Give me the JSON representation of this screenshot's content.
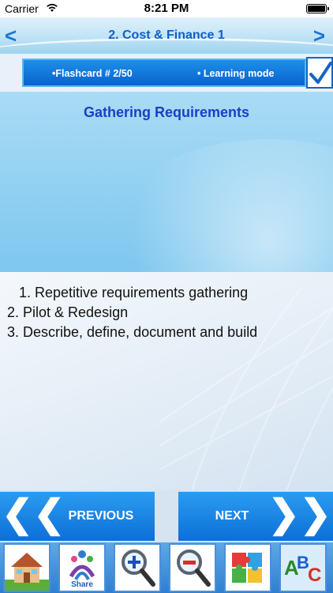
{
  "status_bar": {
    "carrier": "Carrier",
    "time": "8:21 PM"
  },
  "header": {
    "title": "2. Cost & Finance 1",
    "back_glyph": "<",
    "forward_glyph": ">"
  },
  "card_info": {
    "flashcard_label": "•Flashcard #  2/50",
    "mode_label": "• Learning mode",
    "checked": true
  },
  "question": {
    "text": "Gathering Requirements"
  },
  "answers": [
    "1. Repetitive requirements gathering",
    "2. Pilot & Redesign",
    "3. Describe, define, document and build"
  ],
  "buttons": {
    "previous": "PREVIOUS",
    "next": "NEXT"
  },
  "toolbar": {
    "items": [
      {
        "icon": "home-icon",
        "label": ""
      },
      {
        "icon": "share-icon",
        "label": "Share"
      },
      {
        "icon": "zoom-in-icon",
        "label": ""
      },
      {
        "icon": "zoom-out-icon",
        "label": ""
      },
      {
        "icon": "puzzle-icon",
        "label": ""
      },
      {
        "icon": "abc-icon",
        "label": ""
      }
    ]
  },
  "colors": {
    "accent": "#0a62cf",
    "title_blue": "#1160c8",
    "question_blue": "#1a3fc4"
  }
}
